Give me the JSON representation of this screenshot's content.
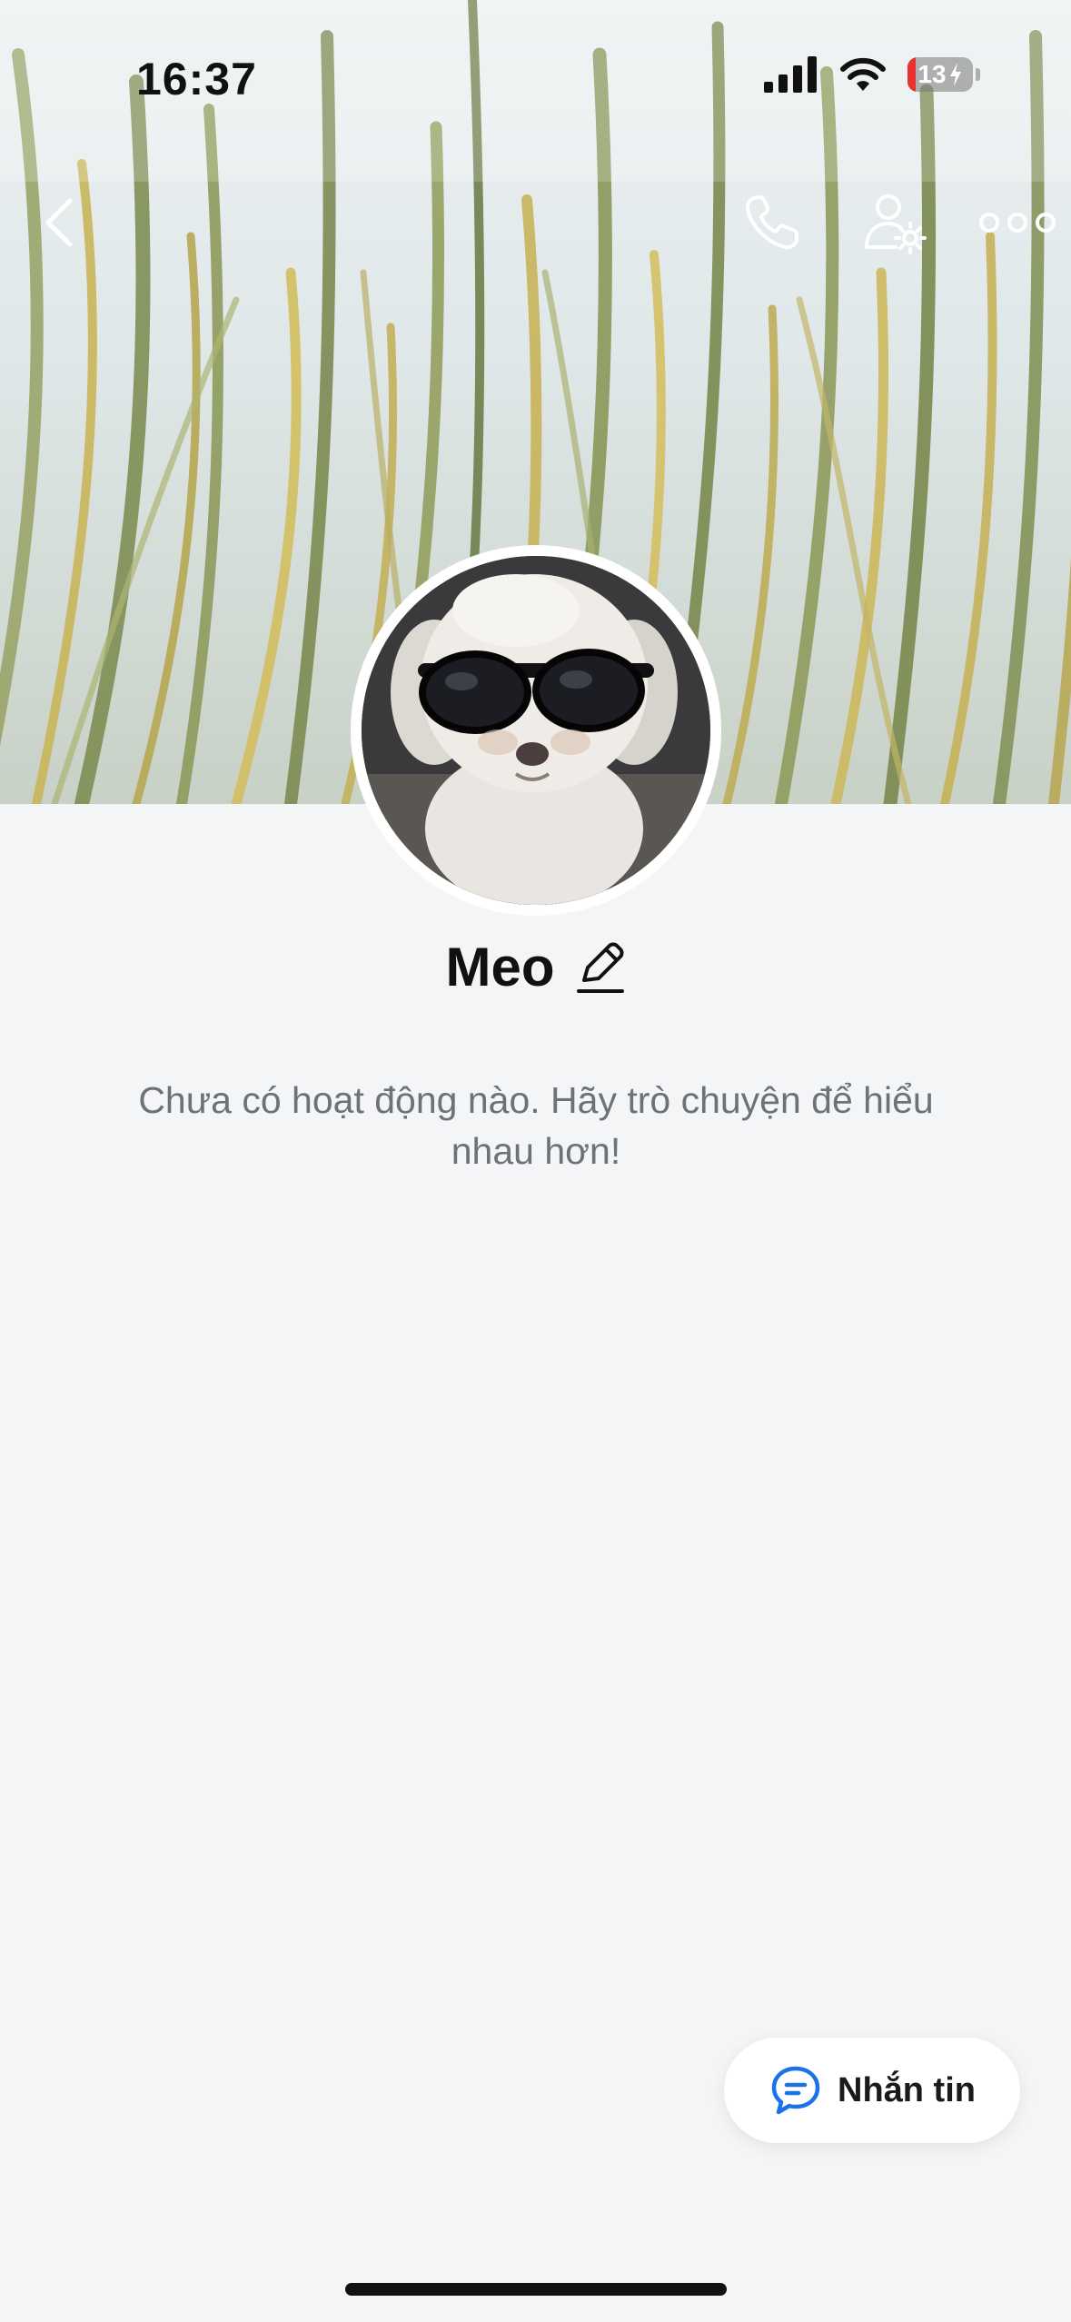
{
  "status_bar": {
    "time": "16:37",
    "battery_level": "13",
    "icons": [
      "cellular-signal-icon",
      "wifi-icon",
      "battery-charging-icon"
    ]
  },
  "nav": {
    "icons": [
      "back-chevron-icon",
      "phone-icon",
      "user-settings-icon",
      "more-dots-icon"
    ]
  },
  "profile": {
    "name": "Meo",
    "empty_message": "Chưa có hoạt động nào. Hãy trò chuyện để hiểu nhau hơn!"
  },
  "actions": {
    "message_label": "Nhắn tin"
  },
  "colors": {
    "background": "#f4f5f7",
    "accent": "#1a73e8",
    "text_primary": "#111111",
    "text_secondary": "#6e7177",
    "battery_low": "#e8322f"
  }
}
